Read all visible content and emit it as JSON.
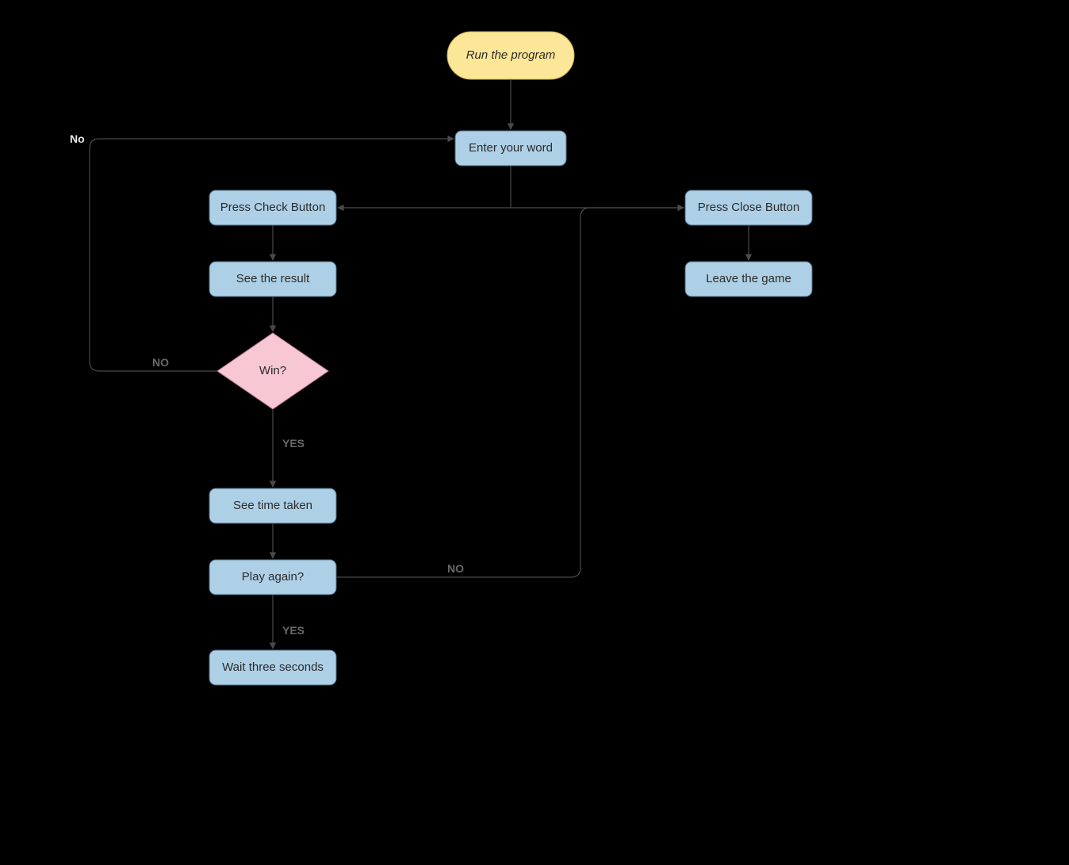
{
  "nodes": {
    "run": {
      "label": "Run the program"
    },
    "enter": {
      "label": "Enter your word"
    },
    "check": {
      "label": "Press Check Button"
    },
    "result": {
      "label": "See the result"
    },
    "win": {
      "label": "Win?"
    },
    "time": {
      "label": "See time taken"
    },
    "again": {
      "label": "Play again?"
    },
    "wait": {
      "label": "Wait three seconds"
    },
    "close": {
      "label": "Press Close Button"
    },
    "leave": {
      "label": "Leave the game"
    }
  },
  "edges": {
    "winNo": {
      "label": "NO"
    },
    "winYes": {
      "label": "YES"
    },
    "againNo": {
      "label": "NO"
    },
    "againYes": {
      "label": "YES"
    },
    "enterNo": {
      "label": "No"
    }
  }
}
